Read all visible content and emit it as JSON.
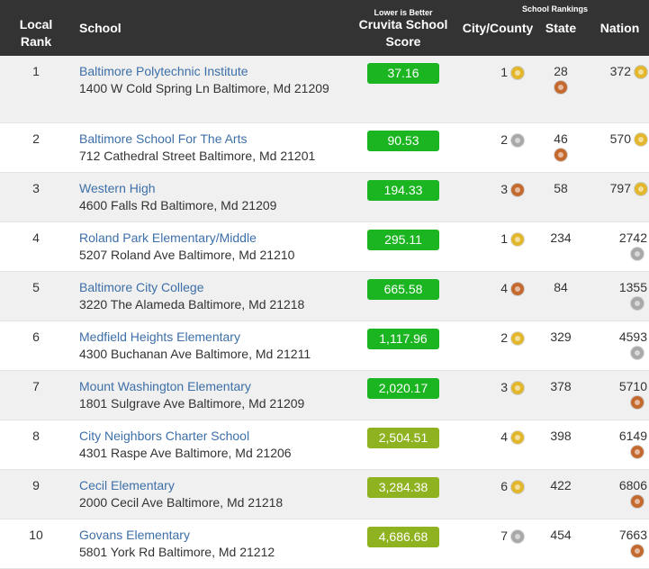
{
  "header": {
    "local_rank": "Local Rank",
    "school": "School",
    "lower_is_better": "Lower is Better",
    "score": "Cruvita School Score",
    "school_rankings": "School Rankings",
    "city_county": "City/County",
    "state": "State",
    "nation": "Nation"
  },
  "colors": {
    "score_green": "#1ab520",
    "score_olive": "#8fb220",
    "link": "#3d6fa8",
    "header_bg": "#333333"
  },
  "rows": [
    {
      "rank": "1",
      "name": "Baltimore Polytechnic Institute",
      "address": "1400 W Cold Spring Ln Baltimore, Md 21209",
      "score": "37.16",
      "score_color": "green",
      "city": "1",
      "city_medal": "gold",
      "state": "28",
      "state_medal": "bronze",
      "nation": "372",
      "nation_medal": "gold"
    },
    {
      "rank": "2",
      "name": "Baltimore School For The Arts",
      "address": "712 Cathedral Street Baltimore, Md 21201",
      "score": "90.53",
      "score_color": "green",
      "city": "2",
      "city_medal": "silver",
      "state": "46",
      "state_medal": "bronze",
      "nation": "570",
      "nation_medal": "gold"
    },
    {
      "rank": "3",
      "name": "Western High",
      "address": "4600 Falls Rd Baltimore, Md 21209",
      "score": "194.33",
      "score_color": "green",
      "city": "3",
      "city_medal": "bronze",
      "state": "58",
      "state_medal": "",
      "nation": "797",
      "nation_medal": "gold"
    },
    {
      "rank": "4",
      "name": "Roland Park Elementary/Middle",
      "address": "5207 Roland Ave Baltimore, Md 21210",
      "score": "295.11",
      "score_color": "green",
      "city": "1",
      "city_medal": "gold",
      "state": "234",
      "state_medal": "",
      "nation": "2742",
      "nation_medal": "silver"
    },
    {
      "rank": "5",
      "name": "Baltimore City College",
      "address": "3220 The Alameda Baltimore, Md 21218",
      "score": "665.58",
      "score_color": "green",
      "city": "4",
      "city_medal": "bronze",
      "state": "84",
      "state_medal": "",
      "nation": "1355",
      "nation_medal": "silver"
    },
    {
      "rank": "6",
      "name": "Medfield Heights Elementary",
      "address": "4300 Buchanan Ave Baltimore, Md 21211",
      "score": "1,117.96",
      "score_color": "green",
      "city": "2",
      "city_medal": "gold",
      "state": "329",
      "state_medal": "",
      "nation": "4593",
      "nation_medal": "silver"
    },
    {
      "rank": "7",
      "name": "Mount Washington Elementary",
      "address": "1801 Sulgrave Ave Baltimore, Md 21209",
      "score": "2,020.17",
      "score_color": "green",
      "city": "3",
      "city_medal": "gold",
      "state": "378",
      "state_medal": "",
      "nation": "5710",
      "nation_medal": "bronze"
    },
    {
      "rank": "8",
      "name": "City Neighbors Charter School",
      "address": "4301 Raspe Ave Baltimore, Md 21206",
      "score": "2,504.51",
      "score_color": "olive",
      "city": "4",
      "city_medal": "gold",
      "state": "398",
      "state_medal": "",
      "nation": "6149",
      "nation_medal": "bronze"
    },
    {
      "rank": "9",
      "name": "Cecil Elementary",
      "address": "2000 Cecil Ave Baltimore, Md 21218",
      "score": "3,284.38",
      "score_color": "olive",
      "city": "6",
      "city_medal": "gold",
      "state": "422",
      "state_medal": "",
      "nation": "6806",
      "nation_medal": "bronze"
    },
    {
      "rank": "10",
      "name": "Govans Elementary",
      "address": "5801 York Rd Baltimore, Md 21212",
      "score": "4,686.68",
      "score_color": "olive",
      "city": "7",
      "city_medal": "silver",
      "state": "454",
      "state_medal": "",
      "nation": "7663",
      "nation_medal": "bronze"
    }
  ]
}
